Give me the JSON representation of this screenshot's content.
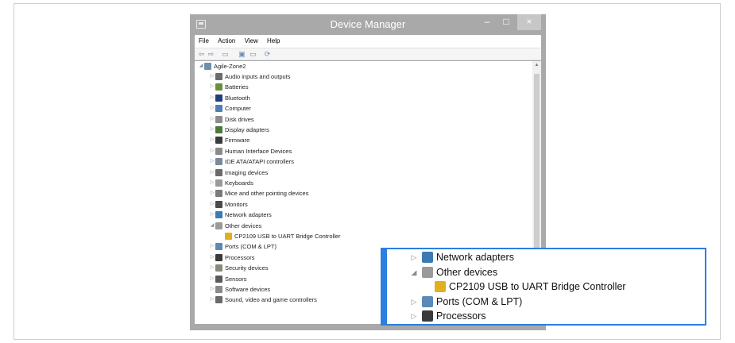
{
  "window": {
    "title": "Device Manager",
    "min_glyph": "–",
    "max_glyph": "□",
    "close_glyph": "×"
  },
  "menu": [
    "File",
    "Action",
    "View",
    "Help"
  ],
  "toolbar": {
    "back_glyph": "⇦",
    "forward_glyph": "⇨",
    "view_glyph": "▭",
    "help_glyph": "▣",
    "props_glyph": "▭",
    "scan_glyph": "⟳"
  },
  "tree": {
    "root": {
      "label": "Agile-Zone2",
      "icon": "computer-icon"
    },
    "items": [
      {
        "label": "Audio inputs and outputs",
        "icon": "speaker-icon",
        "color": "#6b6b6b"
      },
      {
        "label": "Batteries",
        "icon": "battery-icon",
        "color": "#6a8f3a"
      },
      {
        "label": "Bluetooth",
        "icon": "bluetooth-icon",
        "color": "#1f3f7a"
      },
      {
        "label": "Computer",
        "icon": "computer-icon",
        "color": "#4d7fb5"
      },
      {
        "label": "Disk drives",
        "icon": "disk-drive-icon",
        "color": "#8c8c8c"
      },
      {
        "label": "Display adapters",
        "icon": "display-adapter-icon",
        "color": "#4a7a3a"
      },
      {
        "label": "Firmware",
        "icon": "firmware-icon",
        "color": "#3a3a3a"
      },
      {
        "label": "Human Interface Devices",
        "icon": "hid-icon",
        "color": "#8a8a8a"
      },
      {
        "label": "IDE ATA/ATAPI controllers",
        "icon": "ide-controller-icon",
        "color": "#7a8a9a"
      },
      {
        "label": "Imaging devices",
        "icon": "camera-icon",
        "color": "#6a6a6a"
      },
      {
        "label": "Keyboards",
        "icon": "keyboard-icon",
        "color": "#9a9a9a"
      },
      {
        "label": "Mice and other pointing devices",
        "icon": "mouse-icon",
        "color": "#7a7a7a"
      },
      {
        "label": "Monitors",
        "icon": "monitor-icon",
        "color": "#4a4a4a"
      },
      {
        "label": "Network adapters",
        "icon": "network-adapter-icon",
        "color": "#3a7ab5"
      },
      {
        "label": "Other devices",
        "icon": "other-devices-icon",
        "color": "#9a9a9a",
        "expanded": true
      },
      {
        "label": "CP2109 USB to UART Bridge Controller",
        "icon": "warning-device-icon",
        "color": "#e0b020",
        "child": true
      },
      {
        "label": "Ports (COM & LPT)",
        "icon": "port-icon",
        "color": "#5a8ab5"
      },
      {
        "label": "Processors",
        "icon": "processor-icon",
        "color": "#3a3a3a"
      },
      {
        "label": "Security devices",
        "icon": "security-device-icon",
        "color": "#8a8a7a"
      },
      {
        "label": "Sensors",
        "icon": "sensor-icon",
        "color": "#5a5a5a"
      },
      {
        "label": "Software devices",
        "icon": "software-device-icon",
        "color": "#8a8a8a"
      },
      {
        "label": "Sound, video and game controllers",
        "icon": "sound-icon",
        "color": "#6a6a6a"
      }
    ]
  },
  "zoom": {
    "items": [
      {
        "label": "Network adapters",
        "icon": "network-adapter-icon",
        "color": "#3a7ab5"
      },
      {
        "label": "Other devices",
        "icon": "other-devices-icon",
        "color": "#9a9a9a",
        "expanded": true
      },
      {
        "label": "CP2109 USB to UART Bridge Controller",
        "icon": "warning-device-icon",
        "color": "#e0b020",
        "child": true
      },
      {
        "label": "Ports (COM & LPT)",
        "icon": "port-icon",
        "color": "#5a8ab5"
      },
      {
        "label": "Processors",
        "icon": "processor-icon",
        "color": "#3a3a3a"
      }
    ]
  },
  "colors": {
    "window_chrome": "#a9a9a9",
    "highlight_border": "#2a7fe0"
  }
}
